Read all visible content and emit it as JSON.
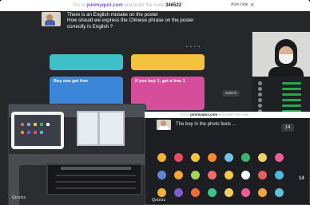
{
  "main_window": {
    "topbar": {
      "prefix": "Go to",
      "site": "joinmyquiz.com",
      "middle": "and enter the code",
      "code": "346522",
      "toggle_label": "Auto-hide",
      "close_symbol": "×"
    },
    "question": {
      "line1": "There is an English mistake on the poster",
      "line2": "How should we express the Chinese phrase on the poster",
      "line3": "correctly in English ?"
    },
    "answers": [
      {
        "label": "",
        "color": "#3fc1c9"
      },
      {
        "label": "",
        "color": "#f4c33d"
      },
      {
        "label": "Buy one get free",
        "color": "#3b86d8"
      },
      {
        "label": "If you buy 1, get a free 1",
        "color": "#d64d9a"
      }
    ],
    "meta_dots": "• • • •",
    "send_button": "Submit"
  },
  "participants": {
    "rows": [
      "",
      "",
      "",
      "",
      "",
      "",
      "",
      ""
    ]
  },
  "photo": {
    "logo": "Quizizz"
  },
  "small_window": {
    "topbar": {
      "prefix": "Go to",
      "site": "joinmyquiz.com",
      "middle": "and enter the code"
    },
    "question": "The boy in the photo feels ...",
    "counter": "14",
    "logo": "Quizizz",
    "side_number": "14"
  },
  "colors": {
    "avatars": [
      "#f2b233",
      "#e84a5f",
      "#f0c53d",
      "#f28c28",
      "#6fc3df",
      "#3fb26f",
      "#f0d060",
      "#e85d9a",
      "#5d87d6",
      "#f2a33a",
      "#a4d65e",
      "#f06b6b",
      "#f2c94c",
      "#ffffff",
      "#e85d5d",
      "#50b8e0",
      "#f2b233",
      "#7c5cd6",
      "#f06b3a",
      "#3fc18f",
      "#f0d060",
      "#e85d9a",
      "#f2a33a",
      "#5dc0d6"
    ]
  }
}
